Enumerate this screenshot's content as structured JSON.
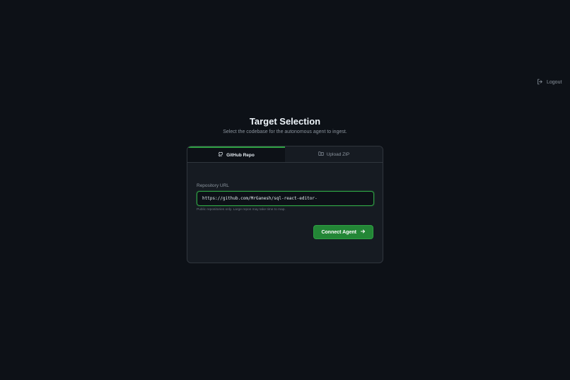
{
  "header": {
    "logout_label": "Logout"
  },
  "main": {
    "title": "Target Selection",
    "subtitle": "Select the codebase for the autonomous agent to ingest."
  },
  "tabs": [
    {
      "label": "GitHub Repo",
      "icon": "github-icon",
      "active": true
    },
    {
      "label": "Upload ZIP",
      "icon": "folder-upload-icon",
      "active": false
    }
  ],
  "form": {
    "repo_label": "Repository URL",
    "repo_value": "https://github.com/MrGanesh/sql-react-editor-",
    "hint": "Public repositories only. Large repos may take time to map.",
    "submit_label": "Connect Agent"
  },
  "colors": {
    "background": "#0d1117",
    "card": "#161b22",
    "accent": "#2ea043",
    "button": "#238636"
  }
}
